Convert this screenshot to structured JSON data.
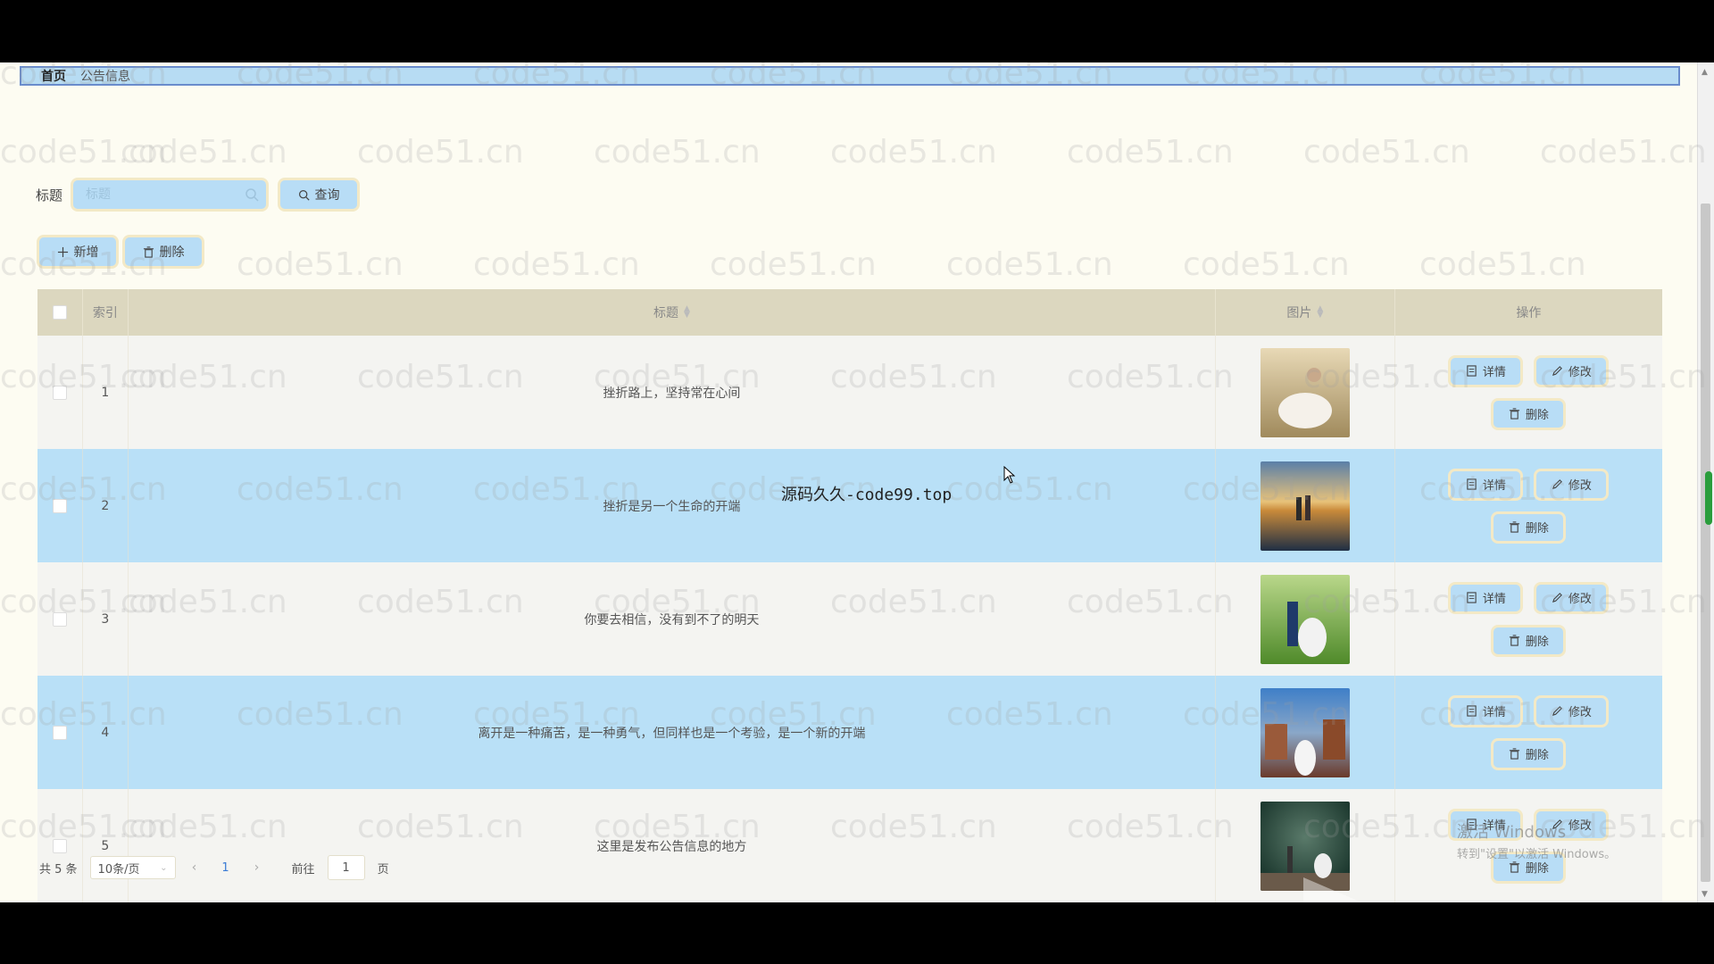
{
  "breadcrumb": {
    "home": "首页",
    "current": "公告信息"
  },
  "search": {
    "label": "标题",
    "placeholder": "标题",
    "query_label": "查询"
  },
  "toolbar": {
    "add_label": "新增",
    "delete_label": "删除"
  },
  "table": {
    "headers": {
      "index": "索引",
      "title": "标题",
      "image": "图片",
      "ops": "操作"
    },
    "rows": [
      {
        "index": "1",
        "title": "挫折路上，坚持常在心间",
        "image": "photo-wedding-field"
      },
      {
        "index": "2",
        "title": "挫折是另一个生命的开端",
        "image": "photo-couple-sunset-water"
      },
      {
        "index": "3",
        "title": "你要去相信，没有到不了的明天",
        "image": "photo-couple-garden"
      },
      {
        "index": "4",
        "title": "离开是一种痛苦，是一种勇气，但同样也是一个考验，是一个新的开端",
        "image": "photo-bride-street"
      },
      {
        "index": "5",
        "title": "这里是发布公告信息的地方",
        "image": "photo-couple-stage"
      }
    ],
    "row_actions": {
      "detail": "详情",
      "edit": "修改",
      "delete": "删除"
    }
  },
  "pagination": {
    "total": "共 5 条",
    "page_size": "10条/页",
    "current_page": "1",
    "goto_prefix": "前往",
    "goto_value": "1",
    "goto_suffix": "页"
  },
  "overlay": {
    "center_watermark": "源码久久-code99.top",
    "watermark_text": "code51.cn",
    "activate_windows_line1": "激活 Windows",
    "activate_windows_line2": "转到\"设置\"以激活 Windows。"
  },
  "colors": {
    "page_bg": "#fdfcf2",
    "accent_blue": "#b8ddf6",
    "header_bg": "#dcd7bf",
    "button_glow": "#f3e9c6"
  }
}
